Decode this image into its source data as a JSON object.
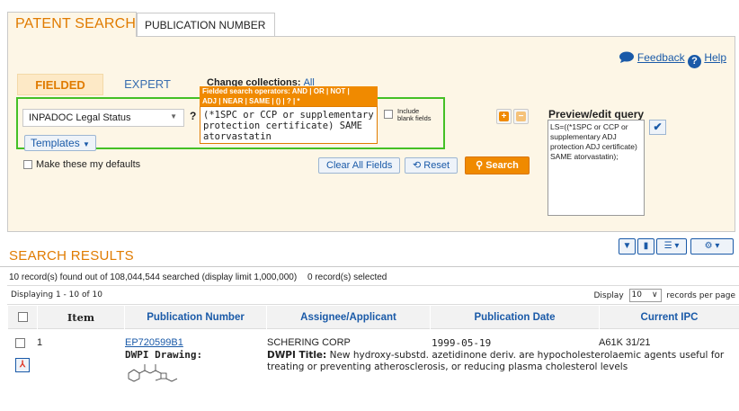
{
  "tabs": {
    "patent_search": "PATENT SEARCH",
    "publication_number": "PUBLICATION NUMBER"
  },
  "header": {
    "feedback": "Feedback",
    "help": "Help"
  },
  "search": {
    "fielded_tab": "FIELDED",
    "expert_tab": "EXPERT",
    "change_collections_label": "Change collections:",
    "change_collections_value": "All",
    "field_select_value": "INPADOC Legal Status",
    "tooltip_line1": "Fielded search operators: AND | OR | NOT |",
    "tooltip_line2": "ADJ | NEAR | SAME | () | ? | *",
    "query_value": "(*1SPC or  CCP or supplementary protection certificate) SAME atorvastatin",
    "include_blank_line1": "Include",
    "include_blank_line2": "blank fields",
    "templates_label": "Templates",
    "make_defaults_label": "Make these my defaults",
    "clear_all_label": "Clear All Fields",
    "reset_label": "Reset",
    "search_label": "Search",
    "preview_title": "Preview/edit query",
    "preview_value": "LS=((*1SPC or CCP or supplementary ADJ protection ADJ certificate) SAME atorvastatin);"
  },
  "results": {
    "title": "SEARCH RESULTS",
    "records_found": "10 record(s) found out of 108,044,544 searched (display limit 1,000,000)",
    "selected": "0 record(s) selected",
    "displaying": "Displaying 1 - 10 of 10",
    "display_label": "Display",
    "display_value": "10",
    "per_page_label": "records per page",
    "columns": {
      "item": "Item",
      "publication_number": "Publication Number",
      "assignee": "Assignee/Applicant",
      "publication_date": "Publication Date",
      "ipc": "Current IPC"
    },
    "rows": [
      {
        "num": "1",
        "publication_number": "EP720599B1",
        "dwpi_drawing_label": "DWPI Drawing:",
        "assignee": "SCHERING CORP",
        "publication_date": "1999-05-19",
        "ipc": "A61K 31/21",
        "dwpi_title_label": "DWPI Title:",
        "dwpi_title": "New hydroxy-substd. azetidinone deriv. are hypocholesterolaemic agents useful for treating or preventing atherosclerosis, or reducing plasma cholesterol levels"
      }
    ]
  },
  "colors": {
    "accent_orange": "#f08a00",
    "link_blue": "#1a5aa8",
    "highlight_green": "#44c026",
    "panel_bg": "#fdf6e6"
  },
  "icons": [
    "feedback-bubble-icon",
    "help-icon",
    "caret-down-icon",
    "plus-icon",
    "minus-icon",
    "reset-icon",
    "search-icon",
    "checkmark-icon",
    "filter-icon",
    "chart-icon",
    "list-icon",
    "gear-icon",
    "pdf-icon"
  ]
}
